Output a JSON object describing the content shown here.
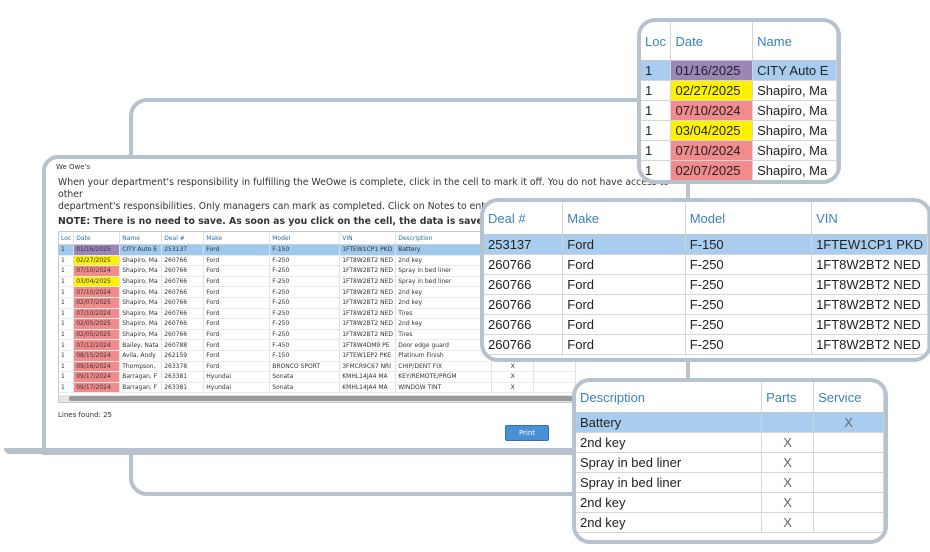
{
  "app": {
    "window_title": "We Owe's",
    "instruction_1": "When your department's responsibility in fulfilling the WeOwe is complete, click in the cell to mark it off. You do not have access to other",
    "instruction_2": "department's responsibilities. Only managers can mark as completed. Click on Notes to enter a Note.",
    "note": "NOTE: There is no need to save. As soon as you click on the cell, the data is saved.",
    "lines_found": "Lines found: 25",
    "print_label": "Print"
  },
  "colors": {
    "date_purple": "#9a86b8",
    "date_yellow": "#fff200",
    "date_red": "#f28b8b",
    "selected_row": "#9cc9ef",
    "accent": "#4a90d6"
  },
  "grid": {
    "columns": [
      "Loc",
      "Date",
      "Name",
      "Deal #",
      "Make",
      "Model",
      "VIN",
      "Description",
      "Parts",
      "Service"
    ],
    "rows": [
      {
        "loc": "1",
        "date": "01/16/2025",
        "date_color": "purple",
        "name": "CITY Auto E",
        "deal": "253137",
        "make": "Ford",
        "model": "F-150",
        "vin": "1FTEW1CP1 PKD",
        "desc": "Battery",
        "parts": "",
        "service": "X",
        "selected": true
      },
      {
        "loc": "1",
        "date": "02/27/2025",
        "date_color": "yellow",
        "name": "Shapiro, Ma",
        "deal": "260766",
        "make": "Ford",
        "model": "F-250",
        "vin": "1FT8W2BT2 NED",
        "desc": "2nd key",
        "parts": "X",
        "service": ""
      },
      {
        "loc": "1",
        "date": "07/10/2024",
        "date_color": "red",
        "name": "Shapiro, Ma",
        "deal": "260766",
        "make": "Ford",
        "model": "F-250",
        "vin": "1FT8W2BT2 NED",
        "desc": "Spray in bed liner",
        "parts": "X",
        "service": ""
      },
      {
        "loc": "1",
        "date": "03/04/2025",
        "date_color": "yellow",
        "name": "Shapiro, Ma",
        "deal": "260766",
        "make": "Ford",
        "model": "F-250",
        "vin": "1FT8W2BT2 NED",
        "desc": "Spray in bed liner",
        "parts": "X",
        "service": ""
      },
      {
        "loc": "1",
        "date": "07/10/2024",
        "date_color": "red",
        "name": "Shapiro, Ma",
        "deal": "260766",
        "make": "Ford",
        "model": "F-250",
        "vin": "1FT8W2BT2 NED",
        "desc": "2nd key",
        "parts": "X",
        "service": ""
      },
      {
        "loc": "1",
        "date": "02/07/2025",
        "date_color": "red",
        "name": "Shapiro, Ma",
        "deal": "260766",
        "make": "Ford",
        "model": "F-250",
        "vin": "1FT8W2BT2 NED",
        "desc": "2nd key",
        "parts": "X",
        "service": ""
      },
      {
        "loc": "1",
        "date": "07/10/2024",
        "date_color": "red",
        "name": "Shapiro, Ma",
        "deal": "260766",
        "make": "Ford",
        "model": "F-250",
        "vin": "1FT8W2BT2 NED",
        "desc": "Tires",
        "parts": "X",
        "service": ""
      },
      {
        "loc": "1",
        "date": "02/05/2025",
        "date_color": "red",
        "name": "Shapiro, Ma",
        "deal": "260766",
        "make": "Ford",
        "model": "F-250",
        "vin": "1FT8W2BT2 NED",
        "desc": "2nd key",
        "parts": "X",
        "service": ""
      },
      {
        "loc": "1",
        "date": "02/05/2025",
        "date_color": "red",
        "name": "Shapiro, Ma",
        "deal": "260766",
        "make": "Ford",
        "model": "F-250",
        "vin": "1FT8W2BT2 NED",
        "desc": "Tires",
        "parts": "X",
        "service": ""
      },
      {
        "loc": "1",
        "date": "07/12/2024",
        "date_color": "red",
        "name": "Bailey, Nata",
        "deal": "260788",
        "make": "Ford",
        "model": "F-450",
        "vin": "1FT8W4DM9 PE",
        "desc": "Door edge guard",
        "parts": "X",
        "service": ""
      },
      {
        "loc": "1",
        "date": "08/15/2024",
        "date_color": "red",
        "name": "Avila, Andy",
        "deal": "262159",
        "make": "Ford",
        "model": "F-150",
        "vin": "1FTEW1EP2 PKE",
        "desc": "Platinum Finish",
        "parts": "X",
        "service": ""
      },
      {
        "loc": "1",
        "date": "09/16/2024",
        "date_color": "red",
        "name": "Thompson,",
        "deal": "263378",
        "make": "Ford",
        "model": "BRONCO SPORT",
        "vin": "3FMCR9C67 NRI",
        "desc": "CHIP/DENT FIX",
        "parts": "X",
        "service": ""
      },
      {
        "loc": "1",
        "date": "09/17/2024",
        "date_color": "red",
        "name": "Barragan, F",
        "deal": "263381",
        "make": "Hyundai",
        "model": "Sonata",
        "vin": "KMHL14JA4 MA",
        "desc": "KEY/REMOTE/PRGM",
        "parts": "X",
        "service": ""
      },
      {
        "loc": "1",
        "date": "09/17/2024",
        "date_color": "red",
        "name": "Barragan, F",
        "deal": "263381",
        "make": "Hyundai",
        "model": "Sonata",
        "vin": "KMHL14JA4 MA",
        "desc": "WINDOW TINT",
        "parts": "X",
        "service": ""
      }
    ]
  },
  "zoom1": {
    "columns": [
      "Loc",
      "Date",
      "Name"
    ],
    "rows": [
      {
        "loc": "1",
        "date": "01/16/2025",
        "date_color": "purple",
        "name": "CITY Auto E",
        "selected": true
      },
      {
        "loc": "1",
        "date": "02/27/2025",
        "date_color": "yellow",
        "name": "Shapiro, Ma"
      },
      {
        "loc": "1",
        "date": "07/10/2024",
        "date_color": "red",
        "name": "Shapiro, Ma"
      },
      {
        "loc": "1",
        "date": "03/04/2025",
        "date_color": "yellow",
        "name": "Shapiro, Ma"
      },
      {
        "loc": "1",
        "date": "07/10/2024",
        "date_color": "red",
        "name": "Shapiro, Ma"
      },
      {
        "loc": "1",
        "date": "02/07/2025",
        "date_color": "red",
        "name": "Shapiro, Ma"
      }
    ]
  },
  "zoom2": {
    "columns": [
      "Deal #",
      "Make",
      "Model",
      "VIN"
    ],
    "rows": [
      {
        "deal": "253137",
        "make": "Ford",
        "model": "F-150",
        "vin": "1FTEW1CP1 PKD",
        "selected": true
      },
      {
        "deal": "260766",
        "make": "Ford",
        "model": "F-250",
        "vin": "1FT8W2BT2 NED"
      },
      {
        "deal": "260766",
        "make": "Ford",
        "model": "F-250",
        "vin": "1FT8W2BT2 NED"
      },
      {
        "deal": "260766",
        "make": "Ford",
        "model": "F-250",
        "vin": "1FT8W2BT2 NED"
      },
      {
        "deal": "260766",
        "make": "Ford",
        "model": "F-250",
        "vin": "1FT8W2BT2 NED"
      },
      {
        "deal": "260766",
        "make": "Ford",
        "model": "F-250",
        "vin": "1FT8W2BT2 NED"
      }
    ]
  },
  "zoom3": {
    "columns": [
      "Description",
      "Parts",
      "Service"
    ],
    "rows": [
      {
        "desc": "Battery",
        "parts": "",
        "service": "X",
        "selected": true
      },
      {
        "desc": "2nd key",
        "parts": "X",
        "service": ""
      },
      {
        "desc": "Spray in bed liner",
        "parts": "X",
        "service": ""
      },
      {
        "desc": "Spray in bed liner",
        "parts": "X",
        "service": ""
      },
      {
        "desc": "2nd key",
        "parts": "X",
        "service": ""
      },
      {
        "desc": "2nd key",
        "parts": "X",
        "service": ""
      }
    ]
  }
}
